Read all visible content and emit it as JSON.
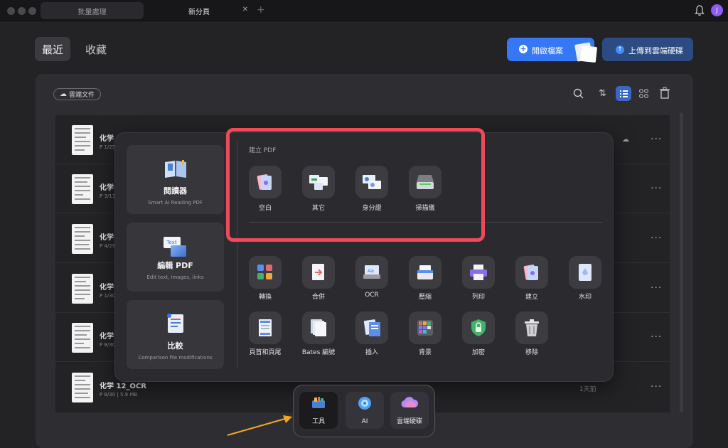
{
  "tabs": [
    {
      "label": "批量處理",
      "active": false
    },
    {
      "label": "新分頁",
      "active": true
    }
  ],
  "avatar_letter": "J",
  "header": {
    "segments": [
      "最近",
      "收藏"
    ],
    "open_file_label": "開啟檔案",
    "upload_cloud_label": "上傳到雲端硬碟"
  },
  "cloud_docs_label": "雲端文件",
  "files": [
    {
      "name": "化学 2",
      "meta": "P 1/25"
    },
    {
      "name": "化学 4",
      "meta": "P 3/13"
    },
    {
      "name": "化学 1",
      "meta": "P 4/29"
    },
    {
      "name": "化学 1",
      "meta": "P 1/30"
    },
    {
      "name": "化学 1",
      "meta": "P 8/30"
    },
    {
      "name": "化学 12_OCR",
      "meta": "P 8/30 | 5.9 MB",
      "time": "1天前"
    }
  ],
  "panel": {
    "side": [
      {
        "title": "閱讀器",
        "sub": "Smart AI Reading PDF",
        "icon": "book-icon"
      },
      {
        "title": "編輯 PDF",
        "sub": "Edit text, images, links",
        "icon": "edit-text-icon"
      },
      {
        "title": "比較",
        "sub": "Comparison file modifications",
        "icon": "compare-icon"
      }
    ],
    "create_section_title": "建立 PDF",
    "create_tools": [
      {
        "label": "空白",
        "icon": "blank-pdf-icon"
      },
      {
        "label": "其它",
        "icon": "other-files-icon"
      },
      {
        "label": "身分證",
        "icon": "id-card-icon"
      },
      {
        "label": "掃描儀",
        "icon": "scanner-icon"
      }
    ],
    "tools_row1": [
      {
        "label": "轉換",
        "icon": "convert-icon"
      },
      {
        "label": "合併",
        "icon": "merge-icon"
      },
      {
        "label": "OCR",
        "icon": "ocr-icon"
      },
      {
        "label": "壓縮",
        "icon": "compress-icon"
      },
      {
        "label": "列印",
        "icon": "print-icon"
      },
      {
        "label": "建立",
        "icon": "create-icon"
      },
      {
        "label": "水印",
        "icon": "watermark-icon"
      }
    ],
    "tools_row2": [
      {
        "label": "頁首和頁尾",
        "icon": "header-footer-icon"
      },
      {
        "label": "Bates 編號",
        "icon": "bates-icon"
      },
      {
        "label": "插入",
        "icon": "insert-icon"
      },
      {
        "label": "背景",
        "icon": "background-icon"
      },
      {
        "label": "加密",
        "icon": "encrypt-icon"
      },
      {
        "label": "移除",
        "icon": "remove-icon"
      }
    ]
  },
  "dock": [
    {
      "label": "工具",
      "icon": "tools-icon",
      "active": true
    },
    {
      "label": "AI",
      "icon": "ai-icon",
      "active": false
    },
    {
      "label": "雲端硬碟",
      "icon": "cloud-drive-icon",
      "active": false
    }
  ],
  "colors": {
    "accent_blue": "#3478f6",
    "highlight_red": "#ee4a5a",
    "arrow_orange": "#f4a623",
    "avatar_purple": "#8e5cf2"
  }
}
